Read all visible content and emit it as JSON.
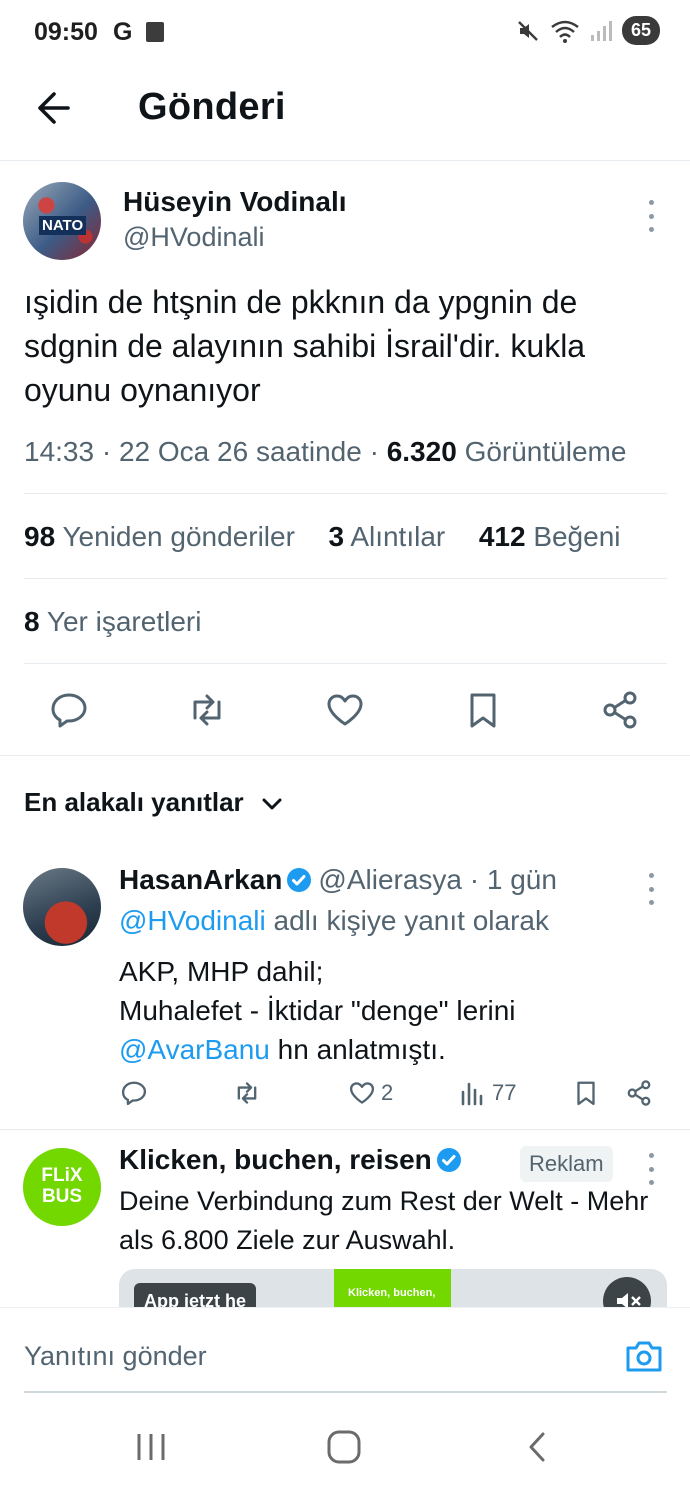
{
  "status_bar": {
    "time": "09:50",
    "g_label": "G",
    "battery": "65"
  },
  "header": {
    "title": "Gönderi"
  },
  "tweet": {
    "author_name": "Hüseyin Vodinalı",
    "author_handle": "@HVodinali",
    "avatar_text": "NATO",
    "text": "ışidin de htşnin de pkknın da ypgnin de sdgnin de alayının sahibi İsrail'dir. kukla oyunu oynanıyor",
    "time": "14:33",
    "date": "22 Oca 26 saatinde",
    "views_count": "6.320",
    "views_label": "Görüntüleme",
    "retweets_count": "98",
    "retweets_label": "Yeniden gönderiler",
    "quotes_count": "3",
    "quotes_label": "Alıntılar",
    "likes_count": "412",
    "likes_label": "Beğeni",
    "bookmarks_count": "8",
    "bookmarks_label": "Yer işaretleri"
  },
  "sort": {
    "label": "En alakalı yanıtlar"
  },
  "reply": {
    "author_name": "HasanArkan",
    "author_handle": "@Alierasya",
    "age": "· 1 gün",
    "reply_to_handle": "@HVodinali",
    "reply_to_suffix": "adlı kişiye yanıt olarak",
    "line1": "AKP, MHP dahil;",
    "line2": "Muhalefet - İktidar \"denge\" lerini",
    "mention": "@AvarBanu",
    "line3_suffix": "hn anlatmıştı.",
    "likes": "2",
    "views": "77"
  },
  "ad": {
    "logo_line1": "FLiX",
    "logo_line2": "BUS",
    "title": "Klicken, buchen, reisen",
    "badge": "Reklam",
    "text": "Deine Verbindung zum Rest der Welt - Mehr als 6.800 Ziele zur Auswahl.",
    "cta": "App jetzt he",
    "thumb_text": "Klicken, buchen,"
  },
  "compose": {
    "placeholder": "Yanıtını gönder"
  },
  "colors": {
    "accent": "#1d9bf0",
    "flixbus": "#73d700",
    "muted": "#536471"
  }
}
